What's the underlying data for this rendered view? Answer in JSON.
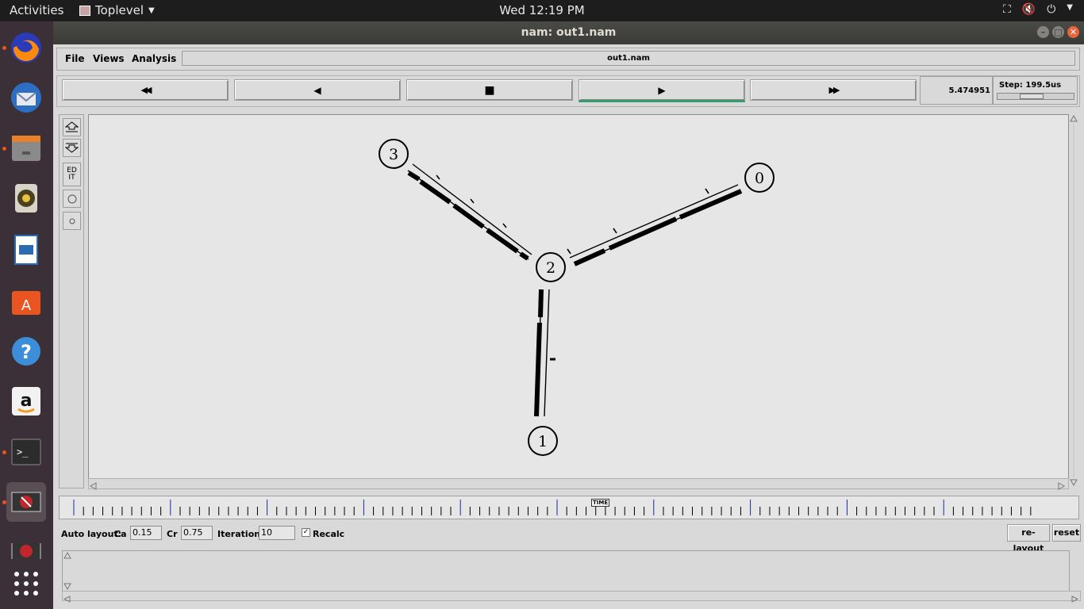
{
  "topbar": {
    "activities": "Activities",
    "app_name": "Toplevel",
    "clock": "Wed 12:19 PM"
  },
  "window": {
    "title": "nam: out1.nam"
  },
  "menu": {
    "file": "File",
    "views": "Views",
    "analysis": "Analysis",
    "filename": "out1.nam"
  },
  "controls": {
    "rewind": "◀◀",
    "back": "◀",
    "stop": "■",
    "play": "▶",
    "fast_forward": "▶▶",
    "time": "5.474951",
    "step_label": "Step: 199.5us"
  },
  "tools": {
    "edit": "ED IT"
  },
  "nodes": [
    {
      "id": "0"
    },
    {
      "id": "1"
    },
    {
      "id": "2"
    },
    {
      "id": "3"
    }
  ],
  "timeline": {
    "label": "TIME"
  },
  "autolayout": {
    "label": "Auto layout:",
    "ca_label": "Ca",
    "ca_value": "0.15",
    "cr_label": "Cr",
    "cr_value": "0.75",
    "iterations_label": "Iterations",
    "iterations_value": "10",
    "recalc_label": "Recalc",
    "relayout_button": "re-layout",
    "reset_button": "reset"
  },
  "dock": {
    "icons": [
      "firefox-icon",
      "thunderbird-icon",
      "files-icon",
      "rhythmbox-icon",
      "writer-icon",
      "software-icon",
      "help-icon",
      "amazon-icon",
      "terminal-icon",
      "nam-icon",
      "apps-grid-icon"
    ]
  }
}
